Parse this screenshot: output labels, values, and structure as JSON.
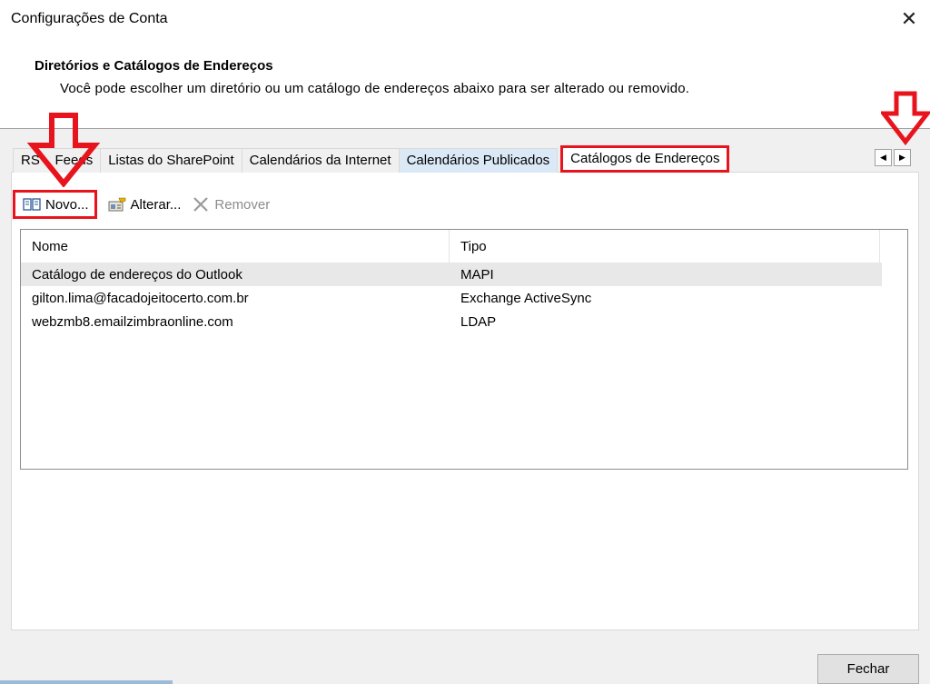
{
  "window": {
    "title": "Configurações de Conta",
    "close_symbol": "✕"
  },
  "header": {
    "section_title": "Diretórios e Catálogos de Endereços",
    "section_description": "Você pode escolher um diretório ou um catálogo de endereços abaixo para ser alterado ou removido."
  },
  "tabs": [
    {
      "label": "RSS Feeds",
      "visible_label": "RS    Feeds"
    },
    {
      "label": "Listas do SharePoint"
    },
    {
      "label": "Calendários da Internet"
    },
    {
      "label": "Calendários Publicados"
    },
    {
      "label": "Catálogos de Endereços",
      "active": true
    }
  ],
  "tab_scroll": {
    "left": "◀",
    "right": "▶"
  },
  "toolbar": {
    "new_label": "Novo...",
    "edit_label": "Alterar...",
    "remove_label": "Remover"
  },
  "list": {
    "columns": [
      "Nome",
      "Tipo"
    ],
    "rows": [
      {
        "name": "Catálogo de endereços do Outlook",
        "type": "MAPI",
        "selected": true
      },
      {
        "name": "gilton.lima@facadojeitocerto.com.br",
        "type": "Exchange ActiveSync"
      },
      {
        "name": "webzmb8.emailzimbraonline.com",
        "type": "LDAP"
      }
    ]
  },
  "footer": {
    "close_label": "Fechar"
  },
  "colors": {
    "highlight": "#e8141d",
    "tab_blue": "#dbe9f7",
    "selected_row": "#e8e8e8"
  }
}
